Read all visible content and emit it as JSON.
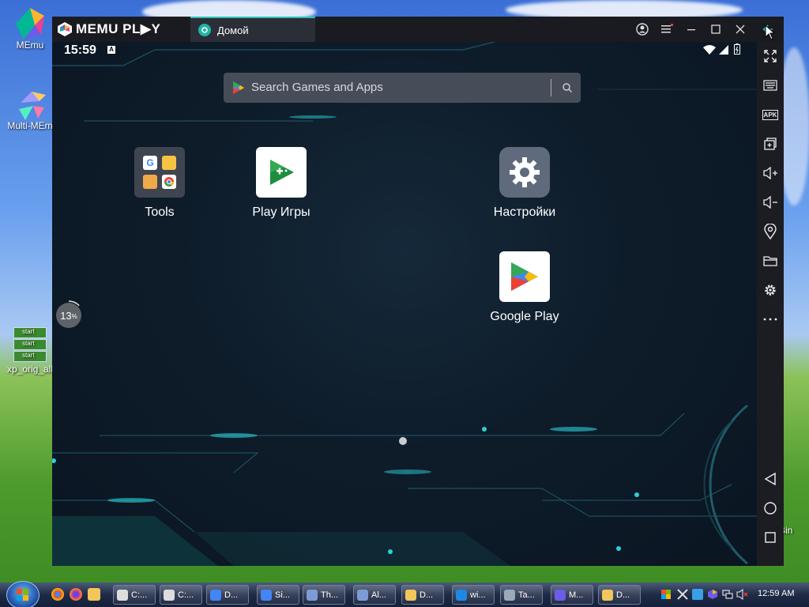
{
  "desktop": {
    "icons": [
      {
        "label": "MEmu"
      },
      {
        "label": "Multi-MEm"
      },
      {
        "label": "xp_orig_all"
      },
      {
        "label": "Bin"
      }
    ],
    "start_lines": [
      "start",
      "start",
      "start"
    ]
  },
  "window": {
    "brand": "MEMU PL▶Y",
    "tab_label": "Домой"
  },
  "android": {
    "clock": "15:59",
    "status_badge": "A",
    "search_placeholder": "Search Games and Apps",
    "apps": [
      {
        "label": "Tools"
      },
      {
        "label": "Play Игры"
      },
      {
        "label": "Настройки"
      },
      {
        "label": "Google Play"
      }
    ],
    "progress": 13,
    "progress_unit": "%",
    "progress_text": "13"
  },
  "toolbar": {
    "apk_label": "APK",
    "items": [
      "fullscreen",
      "keyboard",
      "apk",
      "multi-window",
      "volume-up",
      "volume-down",
      "location",
      "folder",
      "settings",
      "more",
      "back",
      "home",
      "recents"
    ]
  },
  "taskbar": {
    "tasks": [
      {
        "label": "C:..."
      },
      {
        "label": "C:..."
      },
      {
        "label": "D..."
      },
      {
        "label": "Si..."
      },
      {
        "label": "Th..."
      },
      {
        "label": "Al..."
      },
      {
        "label": "D..."
      },
      {
        "label": "wi..."
      },
      {
        "label": "Ta..."
      },
      {
        "label": "M..."
      },
      {
        "label": "D..."
      }
    ],
    "time": "12:59 AM"
  },
  "colors": {
    "accent": "#27c2b2",
    "window_bg": "#14161c",
    "toolbar_bg": "#1b1d23"
  }
}
